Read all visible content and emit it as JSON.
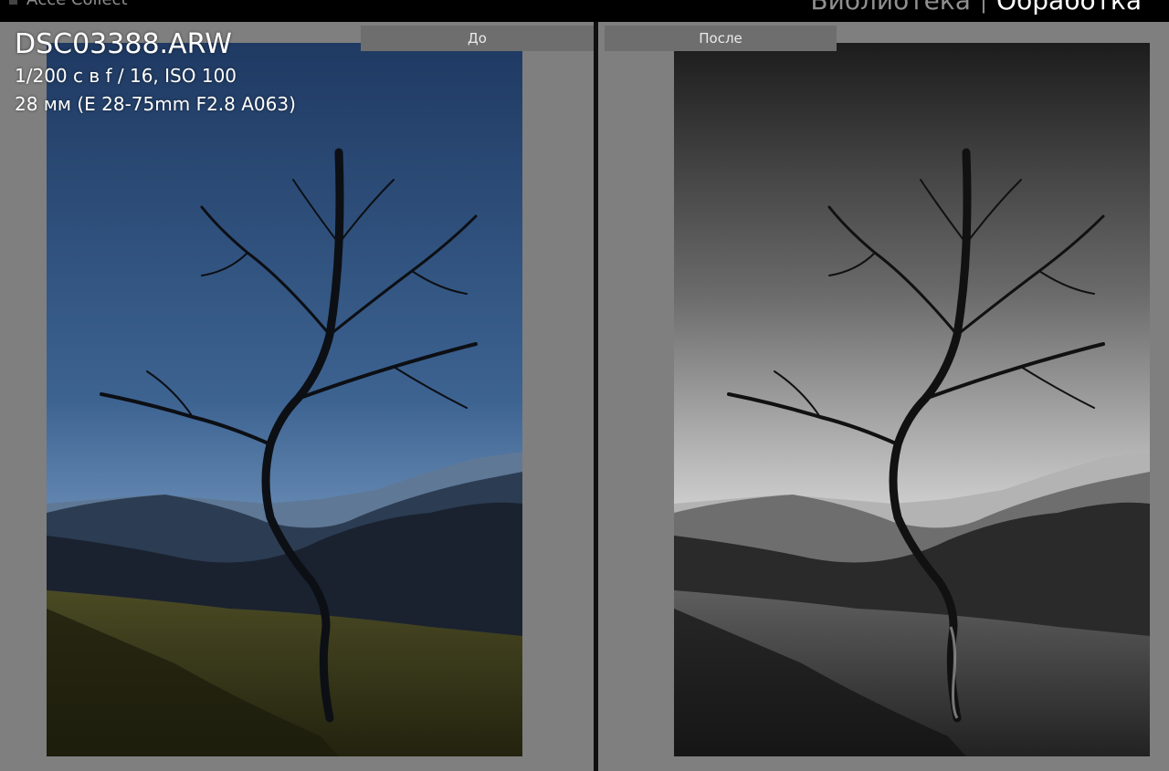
{
  "header": {
    "left_title": "Ассе Collect",
    "modules": [
      "Библиотека",
      "Обработка"
    ],
    "separator": "|"
  },
  "compare": {
    "before_label": "До",
    "after_label": "После"
  },
  "info_overlay": {
    "filename": "DSC03388.ARW",
    "exposure": "1/200 с в f / 16, ISO 100",
    "lens": "28 мм (E 28-75mm F2.8 A063)"
  },
  "colors": {
    "background": "#7f7f7f",
    "topbar": "#000000",
    "tab": "#6e6e6e",
    "divider": "#0f0f0f",
    "sky_before": "#2c4d7a",
    "sky_after": "#d9d9d9"
  }
}
